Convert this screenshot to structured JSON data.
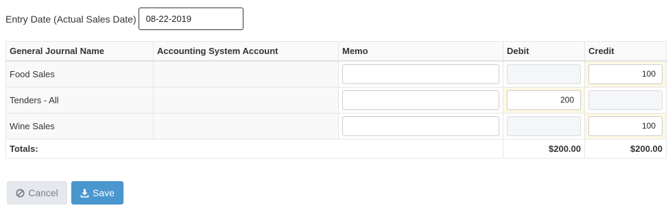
{
  "entry": {
    "label": "Entry Date (Actual Sales Date)",
    "value": "08-22-2019"
  },
  "table": {
    "headers": [
      "General Journal Name",
      "Accounting System Account",
      "Memo",
      "Debit",
      "Credit"
    ],
    "rows": [
      {
        "name": "Food Sales",
        "account": "",
        "memo": "",
        "debit": "",
        "credit": "100"
      },
      {
        "name": "Tenders - All",
        "account": "",
        "memo": "",
        "debit": "200",
        "credit": ""
      },
      {
        "name": "Wine Sales",
        "account": "",
        "memo": "",
        "debit": "",
        "credit": "100"
      }
    ],
    "totals": {
      "label": "Totals:",
      "debit": "$200.00",
      "credit": "$200.00"
    }
  },
  "buttons": {
    "cancel": "Cancel",
    "save": "Save"
  },
  "icons": {
    "cancel": "ban-icon",
    "save": "download-icon"
  },
  "colors": {
    "save_bg": "#4a97d0",
    "cancel_bg": "#e5e8ec",
    "highlight": "#fcf8e3"
  }
}
